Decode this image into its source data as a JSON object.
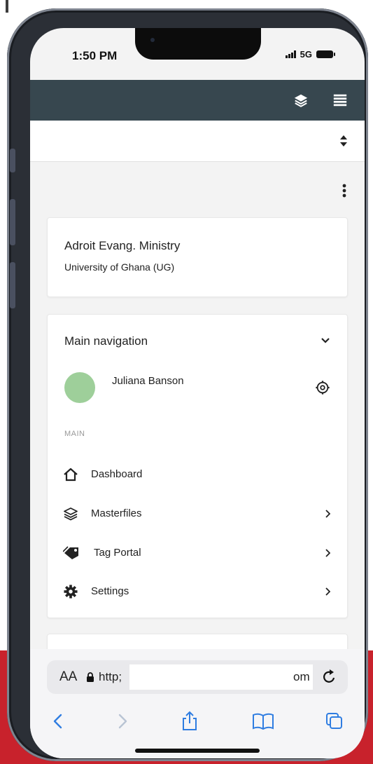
{
  "status_bar": {
    "time": "1:50 PM",
    "network": "5G"
  },
  "app": {
    "organization": {
      "name": "Adroit Evang. Ministry",
      "subtitle": "University of Ghana (UG)"
    },
    "navigation": {
      "title": "Main navigation",
      "user": {
        "name": "Juliana Banson"
      },
      "section_label": "MAIN",
      "items": [
        {
          "label": "Dashboard",
          "icon": "home-icon",
          "has_submenu": false
        },
        {
          "label": "Masterfiles",
          "icon": "layers-icon",
          "has_submenu": true
        },
        {
          "label": "Tag Portal",
          "icon": "tag-icon",
          "has_submenu": true
        },
        {
          "label": "Settings",
          "icon": "gear-icon",
          "has_submenu": true
        }
      ]
    }
  },
  "browser": {
    "text_size_label": "AA",
    "url_visible_start": "http;",
    "url_visible_end": "om"
  },
  "colors": {
    "appbar": "#37474f",
    "avatar": "#9ecf9a",
    "background_accent": "#c8222c"
  }
}
